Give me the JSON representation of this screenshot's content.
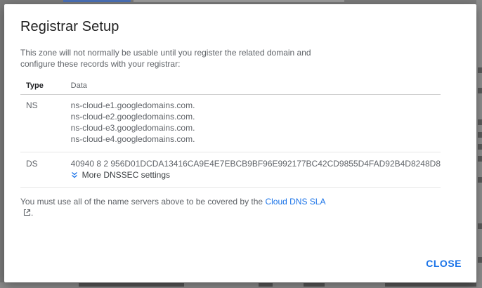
{
  "dialog": {
    "title": "Registrar Setup",
    "intro": "This zone will not normally be usable until you register the related domain and configure these records with your registrar:",
    "table": {
      "headers": {
        "type": "Type",
        "data": "Data"
      },
      "ns": {
        "type": "NS",
        "values": [
          "ns-cloud-e1.googledomains.com.",
          "ns-cloud-e2.googledomains.com.",
          "ns-cloud-e3.googledomains.com.",
          "ns-cloud-e4.googledomains.com."
        ]
      },
      "ds": {
        "type": "DS",
        "value": "40940 8 2 956D01DCDA13416CA9E4E7EBCB9BF96E992177BC42CD9855D4FAD92B4D8248D8",
        "more_label": "More DNSSEC settings"
      }
    },
    "footer": {
      "text": "You must use all of the name servers above to be covered by the ",
      "link_label": "Cloud DNS SLA",
      "suffix": "."
    },
    "close_label": "CLOSE"
  },
  "colors": {
    "accent": "#1a73e8",
    "text_primary": "#212121",
    "text_secondary": "#5f6368"
  }
}
